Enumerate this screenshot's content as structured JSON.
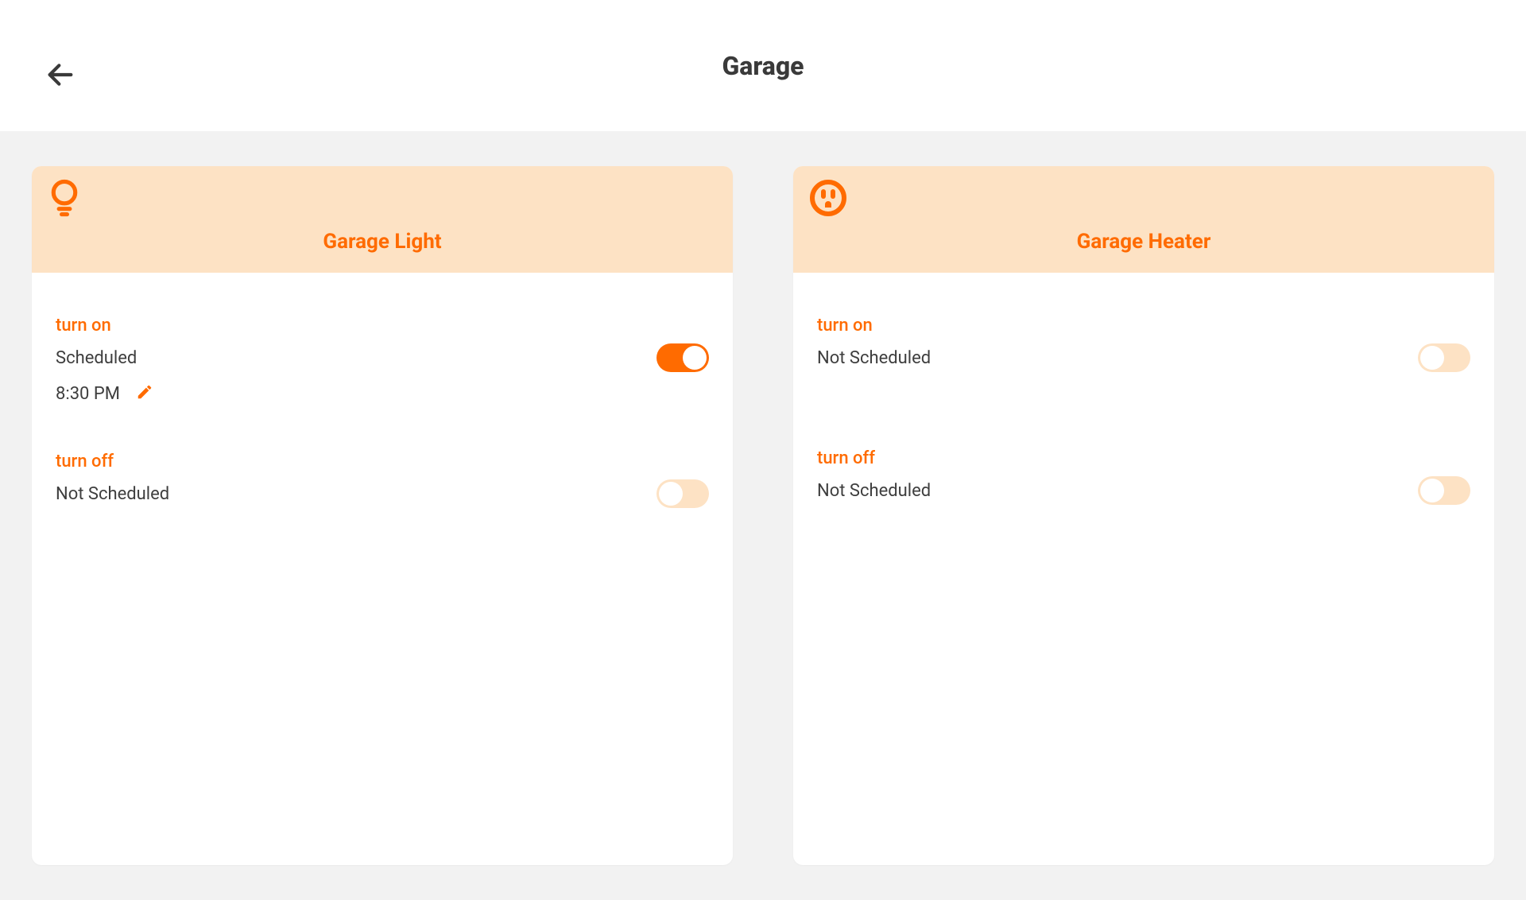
{
  "header": {
    "title": "Garage"
  },
  "devices": [
    {
      "name": "Garage Light",
      "icon": "lightbulb",
      "turn_on": {
        "label": "turn on",
        "status": "Scheduled",
        "enabled": true,
        "time": "8:30 PM"
      },
      "turn_off": {
        "label": "turn off",
        "status": "Not Scheduled",
        "enabled": false,
        "time": null
      }
    },
    {
      "name": "Garage Heater",
      "icon": "outlet",
      "turn_on": {
        "label": "turn on",
        "status": "Not Scheduled",
        "enabled": false,
        "time": null
      },
      "turn_off": {
        "label": "turn off",
        "status": "Not Scheduled",
        "enabled": false,
        "time": null
      }
    }
  ]
}
